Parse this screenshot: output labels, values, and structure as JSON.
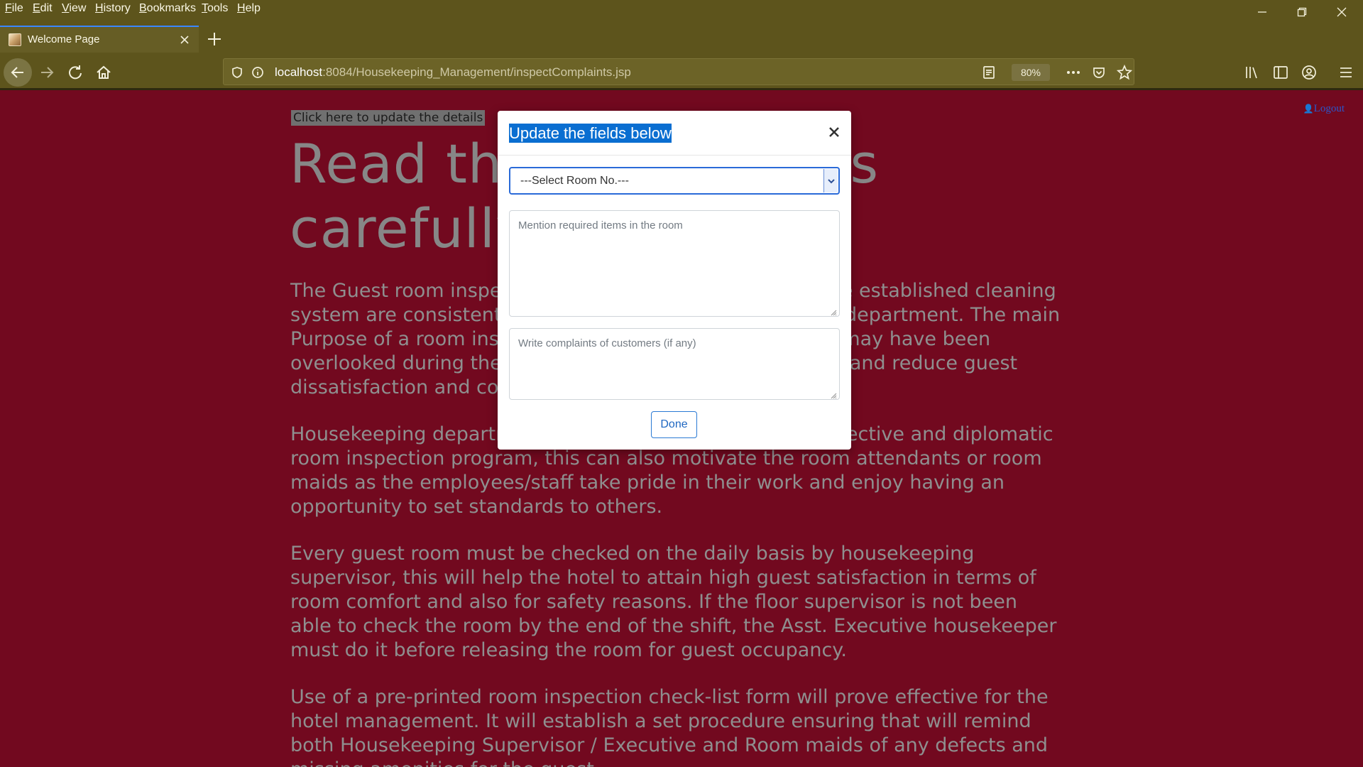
{
  "menubar": {
    "items": [
      "File",
      "Edit",
      "View",
      "History",
      "Bookmarks",
      "Tools",
      "Help"
    ]
  },
  "tab": {
    "title": "Welcome Page",
    "favicon": "page-favicon"
  },
  "navbar": {
    "url_host": "localhost",
    "url_path": ":8084/Housekeeping_Management/inspectComplaints.jsp",
    "zoom": "80%"
  },
  "page": {
    "update_link": "Click here to update the details",
    "logout": "Logout",
    "heading": "Read the instructions carefully...",
    "paragraphs": [
      "The Guest room inspection is necessary to ensure that the established cleaning system are consistently being done by the housekeeping department. The main Purpose of a room inspection is to identify problems that may have been overlooked during the cleaning before it is sold to guests, and reduce guest dissatisfaction and complaints.",
      "Housekeeping department must have a well designed, effective and diplomatic room inspection program, this can also motivate the room attendants or room maids as the employees/staff take pride in their work and enjoy having an opportunity to set standards to others.",
      "Every guest room must be checked on the daily basis by housekeeping supervisor, this will help the hotel to attain high guest satisfaction in terms of room comfort and also for safety reasons. If the floor supervisor is not been able to check the room by the end of the shift, the Asst. Executive housekeeper must do it before releasing the room for guest occupancy.",
      "Use of a pre-printed room inspection check-list form will prove effective for the hotel management. It will establish a set procedure ensuring that will remind both Housekeeping Supervisor / Executive and Room maids of any defects and missing amenities for the guest."
    ]
  },
  "modal": {
    "title": "Update the fields below",
    "close_symbol": "×",
    "room_select": "---Select Room No.---",
    "items_placeholder": "Mention required items in the room",
    "complaints_placeholder": "Write complaints of customers (if any)",
    "done_label": "Done"
  },
  "colors": {
    "chrome": "#5d541c",
    "page_background": "#72091f",
    "accent_blue": "#0a6ed1"
  }
}
